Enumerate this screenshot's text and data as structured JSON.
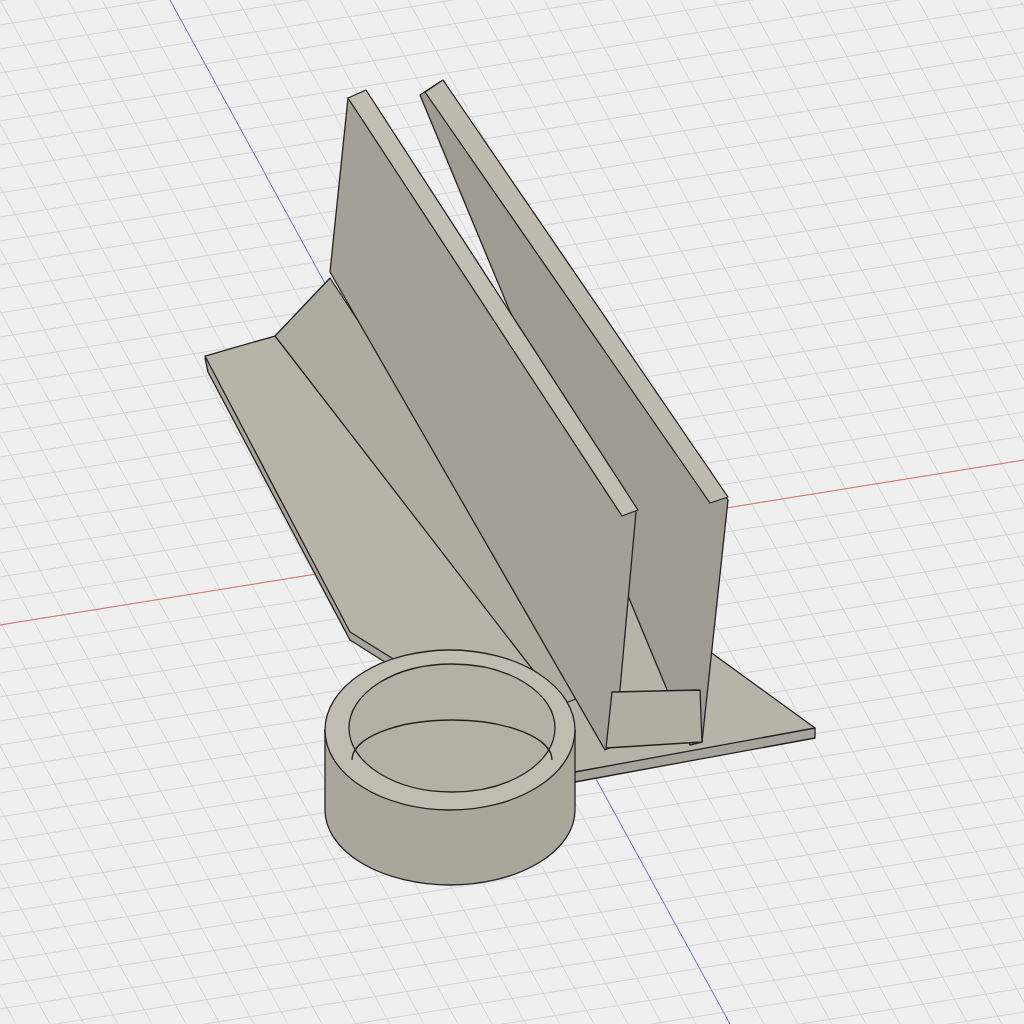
{
  "viewport": {
    "grid": true,
    "axes": [
      {
        "kind": "red",
        "color": "#e07070"
      },
      {
        "kind": "blue",
        "color": "#7070e0"
      }
    ]
  }
}
